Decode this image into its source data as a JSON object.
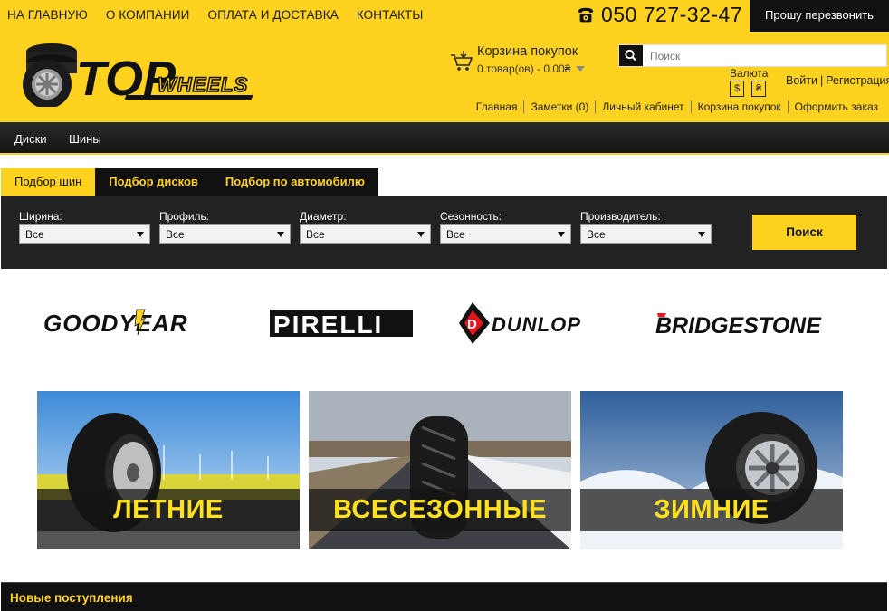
{
  "topnav": {
    "items": [
      "НА ГЛАВНУЮ",
      "О КОМПАНИИ",
      "ОПЛАТА И ДОСТАВКА",
      "КОНТАКТЫ"
    ]
  },
  "phone": {
    "number": "050 727-32-47",
    "icon": "phone-icon"
  },
  "callback": {
    "label": "Прошу перезвонить"
  },
  "logo": {
    "top": "TOP",
    "wheels": "WHEELS"
  },
  "cart": {
    "title": "Корзина покупок",
    "summary": "0 товар(ов) - 0.00₴",
    "icon": "cart-icon"
  },
  "search": {
    "placeholder": "Поиск",
    "icon": "search-icon"
  },
  "currency": {
    "label": "Валюта",
    "options": [
      "$",
      "₴"
    ]
  },
  "auth": {
    "login": "Войти",
    "register": "Регистрация"
  },
  "subnav": [
    "Главная",
    "Заметки (0)",
    "Личный кабинет",
    "Корзина покупок",
    "Оформить заказ"
  ],
  "menu": [
    "Диски",
    "Шины"
  ],
  "tabs": [
    "Подбор шин",
    "Подбор дисков",
    "Подбор по автомобилю"
  ],
  "filters": [
    {
      "label": "Ширина:",
      "value": "Все"
    },
    {
      "label": "Профиль:",
      "value": "Все"
    },
    {
      "label": "Диаметр:",
      "value": "Все"
    },
    {
      "label": "Сезонность:",
      "value": "Все"
    },
    {
      "label": "Производитель:",
      "value": "Все"
    }
  ],
  "search_button": "Поиск",
  "brands": [
    "GOODYEAR",
    "PIRELLI",
    "DUNLOP",
    "BRIDGESTONE"
  ],
  "banners": [
    "ЛЕТНИЕ",
    "ВСЕСЕЗОННЫЕ",
    "ЗИМНИЕ"
  ],
  "news": {
    "title": "Новые поступления"
  },
  "colors": {
    "accent": "#ffd21f",
    "dark": "#111111",
    "panel": "#222222"
  }
}
